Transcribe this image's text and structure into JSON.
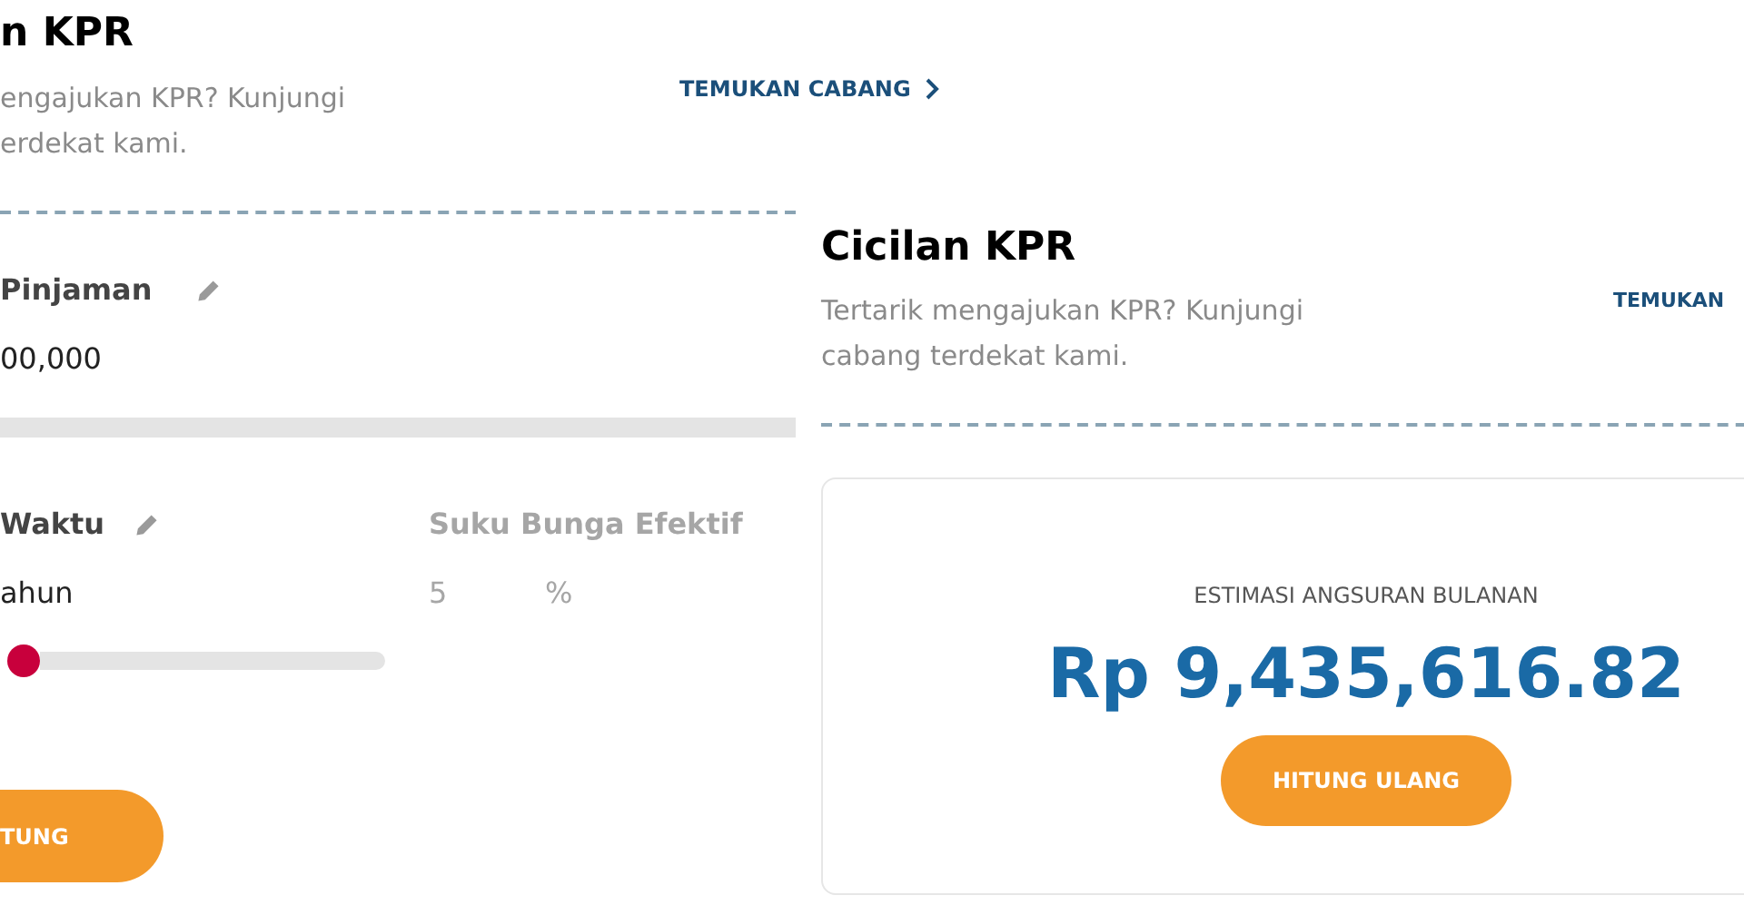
{
  "back_panel": {
    "title": "n KPR",
    "description": [
      "engajukan KPR? Kunjungi",
      "erdekat kami."
    ],
    "branch_link": "TEMUKAN CABANG",
    "loan": {
      "label": "Pinjaman",
      "value": "00,000"
    },
    "term": {
      "label": "Waktu",
      "value": "ahun",
      "level": 0.02
    },
    "rate": {
      "label": "Suku Bunga Efektif",
      "value": "5",
      "unit": "%",
      "disabled": true
    },
    "button": "TUNG"
  },
  "front_panel": {
    "title": "Cicilan KPR",
    "description": [
      "Tertarik mengajukan KPR? Kunjungi",
      "cabang terdekat kami."
    ],
    "branch_link": "TEMUKAN",
    "result": {
      "label": "ESTIMASI ANGSURAN BULANAN",
      "amount": "Rp 9,435,616.82",
      "button": "HITUNG ULANG"
    }
  }
}
